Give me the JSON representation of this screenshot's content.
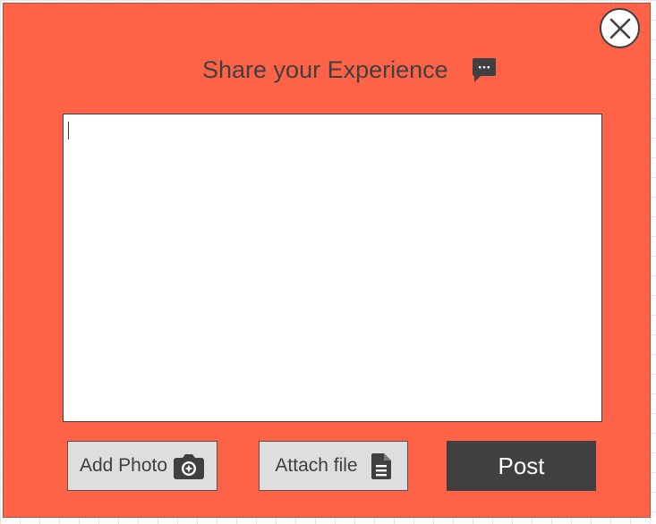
{
  "dialog": {
    "title": "Share your Experience",
    "title_icon": "chat-bubble-icon",
    "close_icon": "close-icon",
    "accent_color": "#ff6347",
    "text_color": "#404040"
  },
  "composer": {
    "value": ""
  },
  "actions": {
    "add_photo_label": "Add Photo",
    "add_photo_icon": "camera-icon",
    "attach_file_label": "Attach file",
    "attach_file_icon": "document-icon",
    "post_label": "Post"
  }
}
